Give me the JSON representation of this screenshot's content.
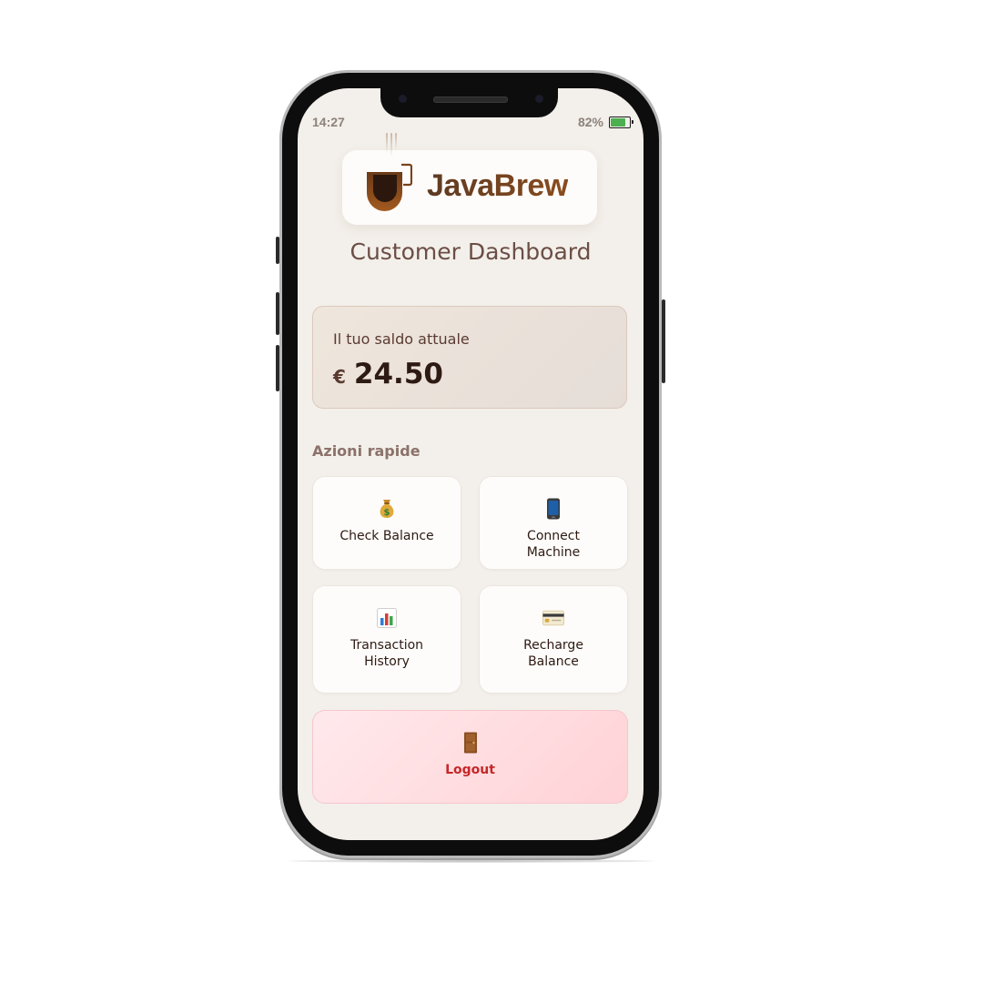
{
  "status_bar": {
    "time": "14:27",
    "battery_text": "82%",
    "battery_level": 0.82
  },
  "logo": {
    "brand_name": "JavaBrew",
    "icon": "coffee-cup-icon"
  },
  "page_title": "Customer Dashboard",
  "balance": {
    "label": "Il tuo saldo attuale",
    "currency": "€",
    "amount": "24.50"
  },
  "quick_actions": {
    "title": "Azioni rapide",
    "items": [
      {
        "label": "Check Balance",
        "icon": "money-bag-icon"
      },
      {
        "label": "Connect Machine",
        "icon": "mobile-phone-icon"
      },
      {
        "label": "Transaction History",
        "icon": "bar-chart-icon"
      },
      {
        "label": "Recharge Balance",
        "icon": "credit-card-icon"
      }
    ]
  },
  "logout": {
    "label": "Logout",
    "icon": "door-icon"
  },
  "colors": {
    "brand_brown": "#6b3f1f",
    "background": "#f3efea",
    "logout_red": "#c62828",
    "battery_green": "#4caf50"
  }
}
